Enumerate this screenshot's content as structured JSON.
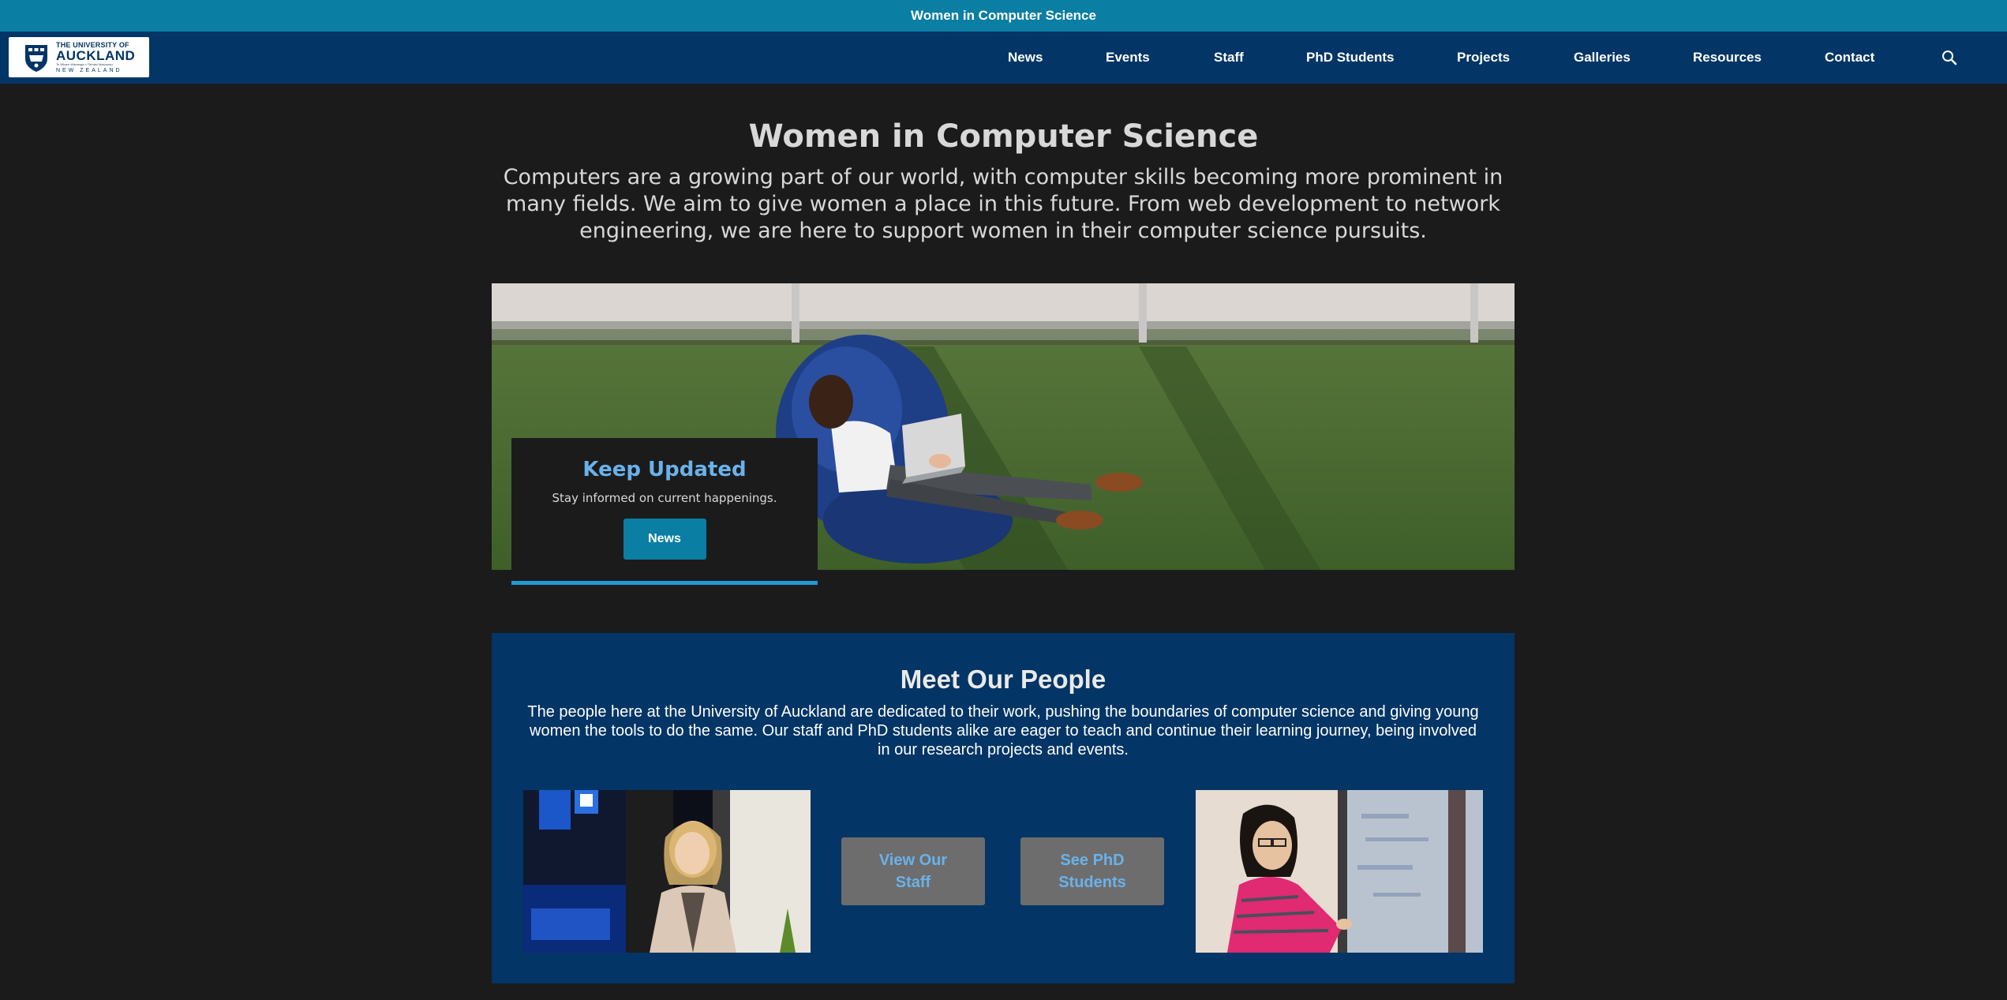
{
  "topbar": {
    "title": "Women in Computer Science"
  },
  "logo": {
    "line1": "THE UNIVERSITY OF",
    "line2": "AUCKLAND",
    "line3": "Te Whare Wānanga o Tāmaki Makaurau",
    "line4": "NEW ZEALAND"
  },
  "nav": {
    "items": [
      "News",
      "Events",
      "Staff",
      "PhD Students",
      "Projects",
      "Galleries",
      "Resources",
      "Contact"
    ],
    "search_icon": "search-icon"
  },
  "hero": {
    "title": "Women in Computer Science",
    "subtitle": "Computers are a growing part of our world, with computer skills becoming more prominent in many fields. We aim to give women a place in this future. From web development to network engineering, we are here to support women in their computer science pursuits."
  },
  "keep_updated": {
    "title": "Keep Updated",
    "text": "Stay informed on current happenings.",
    "button": "News"
  },
  "people": {
    "title": "Meet Our People",
    "text": "The people here at the University of Auckland are dedicated to their work, pushing the boundaries of computer science and giving young women the tools to do the same. Our staff and PhD students alike are eager to teach and continue their learning journey, being involved in our research projects and events.",
    "staff_button": "View Our Staff",
    "phd_button": "See PhD Students"
  },
  "colors": {
    "topbar": "#0b7ea3",
    "navbar": "#033566",
    "background": "#1b1b1c",
    "accent_blue": "#6ab2ea",
    "button_teal": "#0b7ea3",
    "button_grey": "#6d6d6d"
  }
}
